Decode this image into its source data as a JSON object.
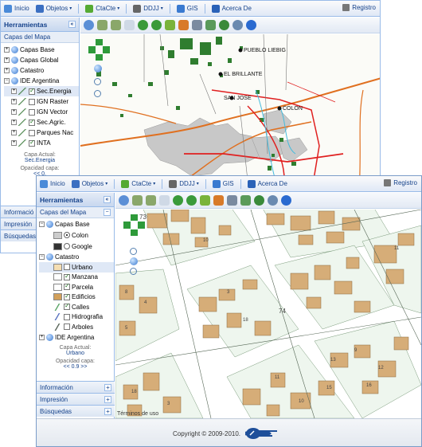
{
  "back_window": {
    "menu": [
      {
        "label": "Inicio",
        "icon": "home-icon",
        "color": "#4a8ad8",
        "dropdown": false
      },
      {
        "label": "Objetos",
        "icon": "objects-icon",
        "color": "#3b6fc2",
        "dropdown": true
      },
      {
        "label": "CtaCte",
        "icon": "account-icon",
        "color": "#55aa33",
        "dropdown": true
      },
      {
        "label": "DDJJ",
        "icon": "ddjj-icon",
        "color": "#666666",
        "dropdown": true
      },
      {
        "label": "GIS",
        "icon": "gis-icon",
        "color": "#3a7ad0",
        "dropdown": false
      },
      {
        "label": "Acerca De",
        "icon": "about-icon",
        "color": "#2a62b8",
        "dropdown": false
      }
    ],
    "registro": "Registro",
    "tools_title": "Herramientas",
    "layers_title": "Capas del Mapa",
    "layers": [
      {
        "label": "Capas Base",
        "type": "group"
      },
      {
        "label": "Capas Global",
        "type": "group"
      },
      {
        "label": "Catastro",
        "type": "group"
      },
      {
        "label": "IDE Argentina",
        "type": "group-open"
      },
      {
        "label": "Sec.Energia",
        "checked": true,
        "selected": true
      },
      {
        "label": "IGN Raster",
        "checked": false
      },
      {
        "label": "IGN Vector",
        "checked": false
      },
      {
        "label": "Sec.Agric.",
        "checked": true
      },
      {
        "label": "Parques Nac",
        "checked": false
      },
      {
        "label": "INTA",
        "checked": true
      }
    ],
    "capa_actual_label": "Capa Actual:",
    "capa_actual_value": "Sec.Energia",
    "opacidad_label": "Opacidad capa:",
    "opacidad_value": "<< 0.",
    "bottom": [
      "Informació",
      "Impresión",
      "Búsquedas"
    ],
    "map_labels": [
      "PUEBLO LIEBIG",
      "EL BRILLANTE",
      "SAN JOSE",
      "COLON"
    ]
  },
  "front_window": {
    "menu": [
      {
        "label": "Inicio",
        "icon": "home-icon",
        "color": "#4a8ad8",
        "dropdown": false
      },
      {
        "label": "Objetos",
        "icon": "objects-icon",
        "color": "#3b6fc2",
        "dropdown": true
      },
      {
        "label": "CtaCte",
        "icon": "account-icon",
        "color": "#55aa33",
        "dropdown": true
      },
      {
        "label": "DDJJ",
        "icon": "ddjj-icon",
        "color": "#666666",
        "dropdown": true
      },
      {
        "label": "GIS",
        "icon": "gis-icon",
        "color": "#3a7ad0",
        "dropdown": false
      },
      {
        "label": "Acerca De",
        "icon": "about-icon",
        "color": "#2a62b8",
        "dropdown": false
      }
    ],
    "registro": "Registro",
    "tools_title": "Herramientas",
    "layers_title": "Capas del Mapa",
    "capas_base": "Capas Base",
    "base_options": [
      {
        "label": "Colon",
        "color": "#cccccc",
        "selected": true
      },
      {
        "label": "Google",
        "color": "#333333",
        "selected": false
      }
    ],
    "catastro": "Catastro",
    "catastro_layers": [
      {
        "label": "Urbano",
        "checked": false,
        "swatch": "#f5deb3",
        "selected": true
      },
      {
        "label": "Manzana",
        "checked": true,
        "swatch": "#ffffff"
      },
      {
        "label": "Parcela",
        "checked": true,
        "swatch": "#ffffff"
      },
      {
        "label": "Edificios",
        "checked": true,
        "swatch": "#d2a05a"
      },
      {
        "label": "Calles",
        "checked": true,
        "swatch": "line-green"
      },
      {
        "label": "Hidrografia",
        "checked": false,
        "swatch": "line-blue"
      },
      {
        "label": "Arboles",
        "checked": false,
        "swatch": "line-dark"
      }
    ],
    "ide": "IDE Argentina",
    "capa_actual_label": "Capa Actual:",
    "capa_actual_value": "Urbano",
    "opacidad_label": "Opacidad capa:",
    "opacidad_value": "<< 0.9 >>",
    "bottom": [
      "Información",
      "Impresión",
      "Búsquedas"
    ],
    "map_numbers": [
      "73",
      "74",
      "18",
      "10",
      "11",
      "13",
      "8",
      "4",
      "5",
      "3",
      "10",
      "15",
      "3",
      "9",
      "12",
      "18",
      "11",
      "16"
    ],
    "terms": "Términos de uso",
    "copyright": "Copyright © 2009-2010."
  }
}
